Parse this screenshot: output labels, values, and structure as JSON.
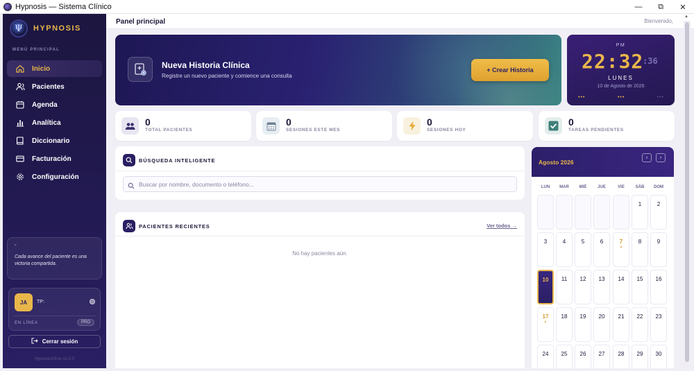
{
  "window": {
    "title": "Hypnosis — Sistema Clínico",
    "minimize": "—",
    "maximize": "⧉",
    "close": "✕"
  },
  "sidebar": {
    "brand": "HYPNOSIS",
    "logo_glyph": "Ψ",
    "menu_title": "MENÚ PRINCIPAL",
    "items": [
      {
        "label": "Inicio",
        "icon": "home-icon",
        "active": true
      },
      {
        "label": "Pacientes",
        "icon": "users-icon"
      },
      {
        "label": "Agenda",
        "icon": "calendar-icon"
      },
      {
        "label": "Analítica",
        "icon": "bar-chart-icon"
      },
      {
        "label": "Diccionario",
        "icon": "book-icon"
      },
      {
        "label": "Facturación",
        "icon": "credit-card-icon"
      },
      {
        "label": "Configuración",
        "icon": "gear-icon"
      }
    ],
    "quote_mark": "“",
    "quote": "Cada avance del paciente es una victoria compartida.",
    "user": {
      "initials": "JA",
      "name": "TP:",
      "status": "EN LÍNEA",
      "badge": "PRO"
    },
    "logout": "Cerrar sesión",
    "version": "HypnosisClinic v1.0.0"
  },
  "header": {
    "title": "Panel principal",
    "welcome": "Bienvenido,"
  },
  "hero": {
    "title": "Nueva Historia Clínica",
    "subtitle": "Registre un nuevo paciente y comience una consulta",
    "button": "+ Crear Historia"
  },
  "clock": {
    "ampm": "PM",
    "time": "22:32",
    "seconds": ":36",
    "day": "LUNES",
    "date": "10 de Agosto de 2026",
    "dots": [
      "•••",
      "•••",
      "•••"
    ]
  },
  "stats": [
    {
      "value": "0",
      "label": "TOTAL PACIENTES",
      "icon": "users-icon"
    },
    {
      "value": "0",
      "label": "SESIONES ESTE MES",
      "icon": "calendar-grid-icon"
    },
    {
      "value": "0",
      "label": "SESIONES HOY",
      "icon": "lightning-icon"
    },
    {
      "value": "0",
      "label": "TAREAS PENDIENTES",
      "icon": "checkbox-icon"
    }
  ],
  "search": {
    "title": "BÚSQUEDA INTELIGENTE",
    "placeholder": "Buscar por nombre, documento o teléfono..."
  },
  "recent": {
    "title": "PACIENTES RECIENTES",
    "view_all": "Ver todos →",
    "empty": "No hay pacientes aún."
  },
  "calendar": {
    "month": "Agosto 2026",
    "prev": "‹",
    "next": "›",
    "weekdays": [
      "LUN",
      "MAR",
      "MIÉ",
      "JUE",
      "VIE",
      "SÁB",
      "DOM"
    ],
    "leading_empty": 5,
    "days": [
      "1",
      "2",
      "3",
      "4",
      "5",
      "6",
      "7",
      "8",
      "9",
      "10",
      "11",
      "12",
      "13",
      "14",
      "15",
      "16",
      "17",
      "18",
      "19",
      "20",
      "21",
      "22",
      "23",
      "24",
      "25",
      "26",
      "27",
      "28",
      "29",
      "30"
    ],
    "today": "10",
    "marked": [
      "7",
      "17"
    ]
  },
  "colors": {
    "accent_gold": "#e9b64a",
    "sidebar_dark": "#1c1640",
    "primary_purple": "#2a1f63"
  }
}
